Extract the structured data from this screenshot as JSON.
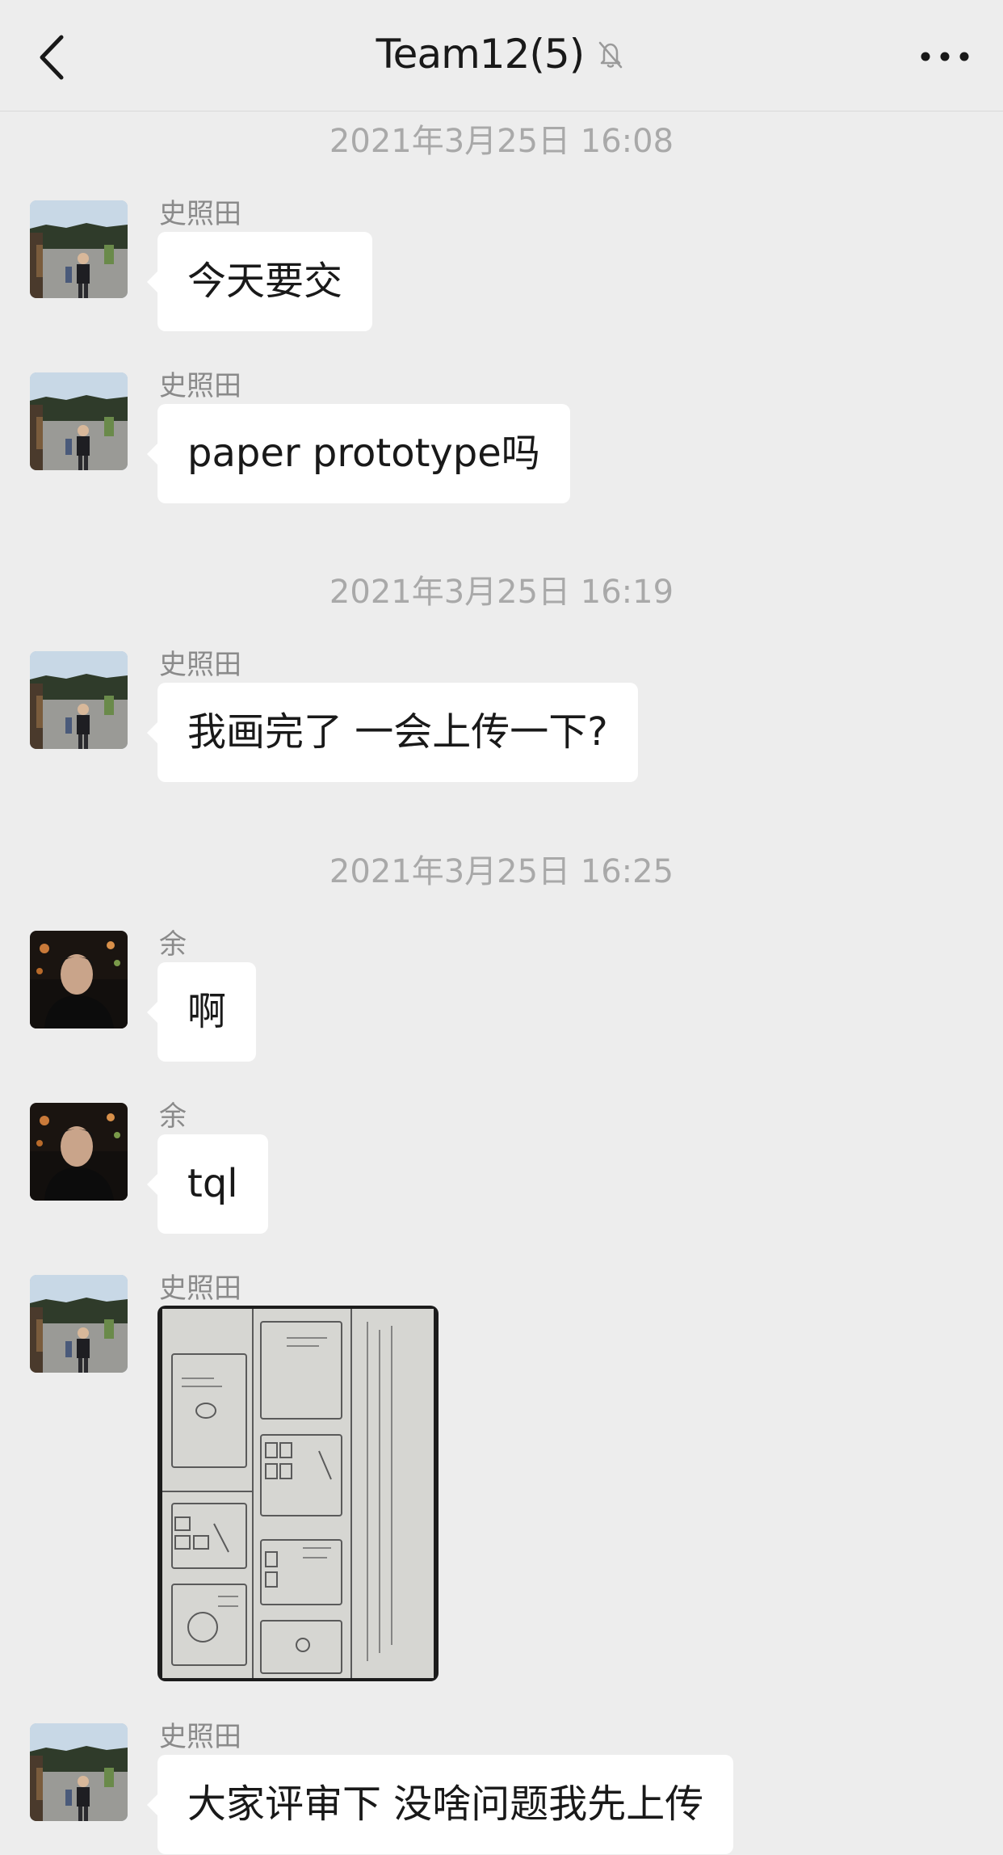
{
  "header": {
    "title": "Team12(5)",
    "back_icon": "chevron-left-icon",
    "mute_icon": "bell-slash-icon",
    "more_icon": "more-dots-icon"
  },
  "timestamps": [
    "2021年3月25日 16:08",
    "2021年3月25日 16:19",
    "2021年3月25日 16:25"
  ],
  "messages": [
    {
      "sender": "史照田",
      "text": "今天要交"
    },
    {
      "sender": "史照田",
      "text": "paper prototype吗"
    },
    {
      "sender": "史照田",
      "text": "我画完了 一会上传一下?"
    },
    {
      "sender": "余",
      "text": "啊"
    },
    {
      "sender": "余",
      "text": "tql"
    },
    {
      "sender": "史照田",
      "text": ""
    },
    {
      "sender": "史照田",
      "text": "大家评审下 没啥问题我先上传"
    }
  ],
  "colors": {
    "background": "#ededed",
    "bubble": "#ffffff",
    "timestamp": "#a9a9a9",
    "sender": "#8a8a8a"
  }
}
